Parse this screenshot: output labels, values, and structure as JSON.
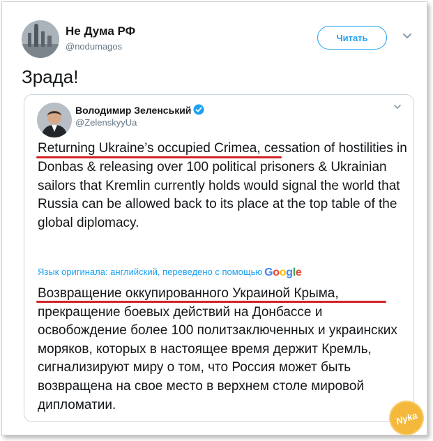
{
  "tweet": {
    "display_name": "Не Дума РФ",
    "handle": "@nodumagos",
    "follow_label": "Читать",
    "text": "Зрада!"
  },
  "quoted_tweet": {
    "display_name": "Володимир Зеленський",
    "handle": "@ZelenskyyUa",
    "verified": true,
    "text_en": {
      "highlight": "Returning Ukraine’s occupied Crimea",
      "rest": ", cessation of hostilities in Donbas & releasing over 100 political prisoners & Ukrainian sailors that Kremlin currently holds would signal the world that Russia can be allowed back to its place at the top table of the global diplomacy."
    },
    "translation_note": "Язык оригинала: английский, переведено с помощью",
    "translation_provider": "Google",
    "text_ru": {
      "highlight": "Возвращение оккупированного Украиной Крыма",
      "rest": ", прекращение боевых действий на Донбассе и освобождение более 100 политзаключенных и украинских моряков, которых в настоящее время держит Кремль, сигнализируют миру о том, что Россия может быть возвращена на свое место в верхнем столе мировой дипломатии."
    }
  },
  "watermark": {
    "text": "Nyka"
  },
  "colors": {
    "accent": "#1da1f2",
    "text": "#14171a",
    "muted": "#657786",
    "highlight_underline": "#d2232a",
    "border": "#cdd6dd"
  },
  "icons": [
    "avatar-nodumagos",
    "chevron-down-icon",
    "verified-badge-icon",
    "avatar-zelenskyy"
  ]
}
